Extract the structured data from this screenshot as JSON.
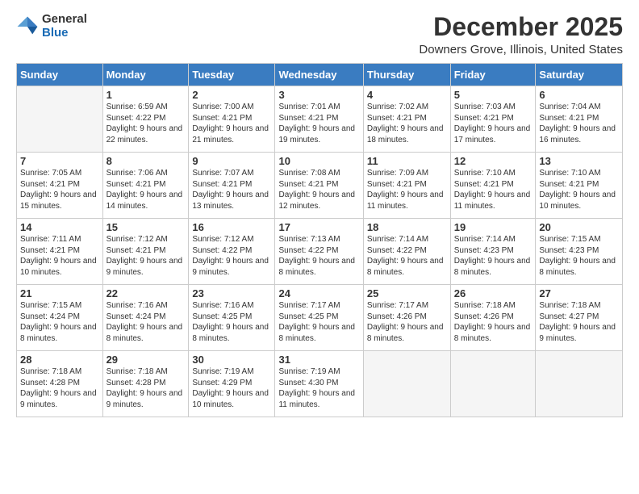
{
  "logo": {
    "general": "General",
    "blue": "Blue"
  },
  "title": "December 2025",
  "location": "Downers Grove, Illinois, United States",
  "days_of_week": [
    "Sunday",
    "Monday",
    "Tuesday",
    "Wednesday",
    "Thursday",
    "Friday",
    "Saturday"
  ],
  "weeks": [
    [
      {
        "day": "",
        "empty": true
      },
      {
        "day": "1",
        "sunrise": "Sunrise: 6:59 AM",
        "sunset": "Sunset: 4:22 PM",
        "daylight": "Daylight: 9 hours and 22 minutes."
      },
      {
        "day": "2",
        "sunrise": "Sunrise: 7:00 AM",
        "sunset": "Sunset: 4:21 PM",
        "daylight": "Daylight: 9 hours and 21 minutes."
      },
      {
        "day": "3",
        "sunrise": "Sunrise: 7:01 AM",
        "sunset": "Sunset: 4:21 PM",
        "daylight": "Daylight: 9 hours and 19 minutes."
      },
      {
        "day": "4",
        "sunrise": "Sunrise: 7:02 AM",
        "sunset": "Sunset: 4:21 PM",
        "daylight": "Daylight: 9 hours and 18 minutes."
      },
      {
        "day": "5",
        "sunrise": "Sunrise: 7:03 AM",
        "sunset": "Sunset: 4:21 PM",
        "daylight": "Daylight: 9 hours and 17 minutes."
      },
      {
        "day": "6",
        "sunrise": "Sunrise: 7:04 AM",
        "sunset": "Sunset: 4:21 PM",
        "daylight": "Daylight: 9 hours and 16 minutes."
      }
    ],
    [
      {
        "day": "7",
        "sunrise": "Sunrise: 7:05 AM",
        "sunset": "Sunset: 4:21 PM",
        "daylight": "Daylight: 9 hours and 15 minutes."
      },
      {
        "day": "8",
        "sunrise": "Sunrise: 7:06 AM",
        "sunset": "Sunset: 4:21 PM",
        "daylight": "Daylight: 9 hours and 14 minutes."
      },
      {
        "day": "9",
        "sunrise": "Sunrise: 7:07 AM",
        "sunset": "Sunset: 4:21 PM",
        "daylight": "Daylight: 9 hours and 13 minutes."
      },
      {
        "day": "10",
        "sunrise": "Sunrise: 7:08 AM",
        "sunset": "Sunset: 4:21 PM",
        "daylight": "Daylight: 9 hours and 12 minutes."
      },
      {
        "day": "11",
        "sunrise": "Sunrise: 7:09 AM",
        "sunset": "Sunset: 4:21 PM",
        "daylight": "Daylight: 9 hours and 11 minutes."
      },
      {
        "day": "12",
        "sunrise": "Sunrise: 7:10 AM",
        "sunset": "Sunset: 4:21 PM",
        "daylight": "Daylight: 9 hours and 11 minutes."
      },
      {
        "day": "13",
        "sunrise": "Sunrise: 7:10 AM",
        "sunset": "Sunset: 4:21 PM",
        "daylight": "Daylight: 9 hours and 10 minutes."
      }
    ],
    [
      {
        "day": "14",
        "sunrise": "Sunrise: 7:11 AM",
        "sunset": "Sunset: 4:21 PM",
        "daylight": "Daylight: 9 hours and 10 minutes."
      },
      {
        "day": "15",
        "sunrise": "Sunrise: 7:12 AM",
        "sunset": "Sunset: 4:21 PM",
        "daylight": "Daylight: 9 hours and 9 minutes."
      },
      {
        "day": "16",
        "sunrise": "Sunrise: 7:12 AM",
        "sunset": "Sunset: 4:22 PM",
        "daylight": "Daylight: 9 hours and 9 minutes."
      },
      {
        "day": "17",
        "sunrise": "Sunrise: 7:13 AM",
        "sunset": "Sunset: 4:22 PM",
        "daylight": "Daylight: 9 hours and 8 minutes."
      },
      {
        "day": "18",
        "sunrise": "Sunrise: 7:14 AM",
        "sunset": "Sunset: 4:22 PM",
        "daylight": "Daylight: 9 hours and 8 minutes."
      },
      {
        "day": "19",
        "sunrise": "Sunrise: 7:14 AM",
        "sunset": "Sunset: 4:23 PM",
        "daylight": "Daylight: 9 hours and 8 minutes."
      },
      {
        "day": "20",
        "sunrise": "Sunrise: 7:15 AM",
        "sunset": "Sunset: 4:23 PM",
        "daylight": "Daylight: 9 hours and 8 minutes."
      }
    ],
    [
      {
        "day": "21",
        "sunrise": "Sunrise: 7:15 AM",
        "sunset": "Sunset: 4:24 PM",
        "daylight": "Daylight: 9 hours and 8 minutes."
      },
      {
        "day": "22",
        "sunrise": "Sunrise: 7:16 AM",
        "sunset": "Sunset: 4:24 PM",
        "daylight": "Daylight: 9 hours and 8 minutes."
      },
      {
        "day": "23",
        "sunrise": "Sunrise: 7:16 AM",
        "sunset": "Sunset: 4:25 PM",
        "daylight": "Daylight: 9 hours and 8 minutes."
      },
      {
        "day": "24",
        "sunrise": "Sunrise: 7:17 AM",
        "sunset": "Sunset: 4:25 PM",
        "daylight": "Daylight: 9 hours and 8 minutes."
      },
      {
        "day": "25",
        "sunrise": "Sunrise: 7:17 AM",
        "sunset": "Sunset: 4:26 PM",
        "daylight": "Daylight: 9 hours and 8 minutes."
      },
      {
        "day": "26",
        "sunrise": "Sunrise: 7:18 AM",
        "sunset": "Sunset: 4:26 PM",
        "daylight": "Daylight: 9 hours and 8 minutes."
      },
      {
        "day": "27",
        "sunrise": "Sunrise: 7:18 AM",
        "sunset": "Sunset: 4:27 PM",
        "daylight": "Daylight: 9 hours and 9 minutes."
      }
    ],
    [
      {
        "day": "28",
        "sunrise": "Sunrise: 7:18 AM",
        "sunset": "Sunset: 4:28 PM",
        "daylight": "Daylight: 9 hours and 9 minutes."
      },
      {
        "day": "29",
        "sunrise": "Sunrise: 7:18 AM",
        "sunset": "Sunset: 4:28 PM",
        "daylight": "Daylight: 9 hours and 9 minutes."
      },
      {
        "day": "30",
        "sunrise": "Sunrise: 7:19 AM",
        "sunset": "Sunset: 4:29 PM",
        "daylight": "Daylight: 9 hours and 10 minutes."
      },
      {
        "day": "31",
        "sunrise": "Sunrise: 7:19 AM",
        "sunset": "Sunset: 4:30 PM",
        "daylight": "Daylight: 9 hours and 11 minutes."
      },
      {
        "day": "",
        "empty": true
      },
      {
        "day": "",
        "empty": true
      },
      {
        "day": "",
        "empty": true
      }
    ]
  ]
}
